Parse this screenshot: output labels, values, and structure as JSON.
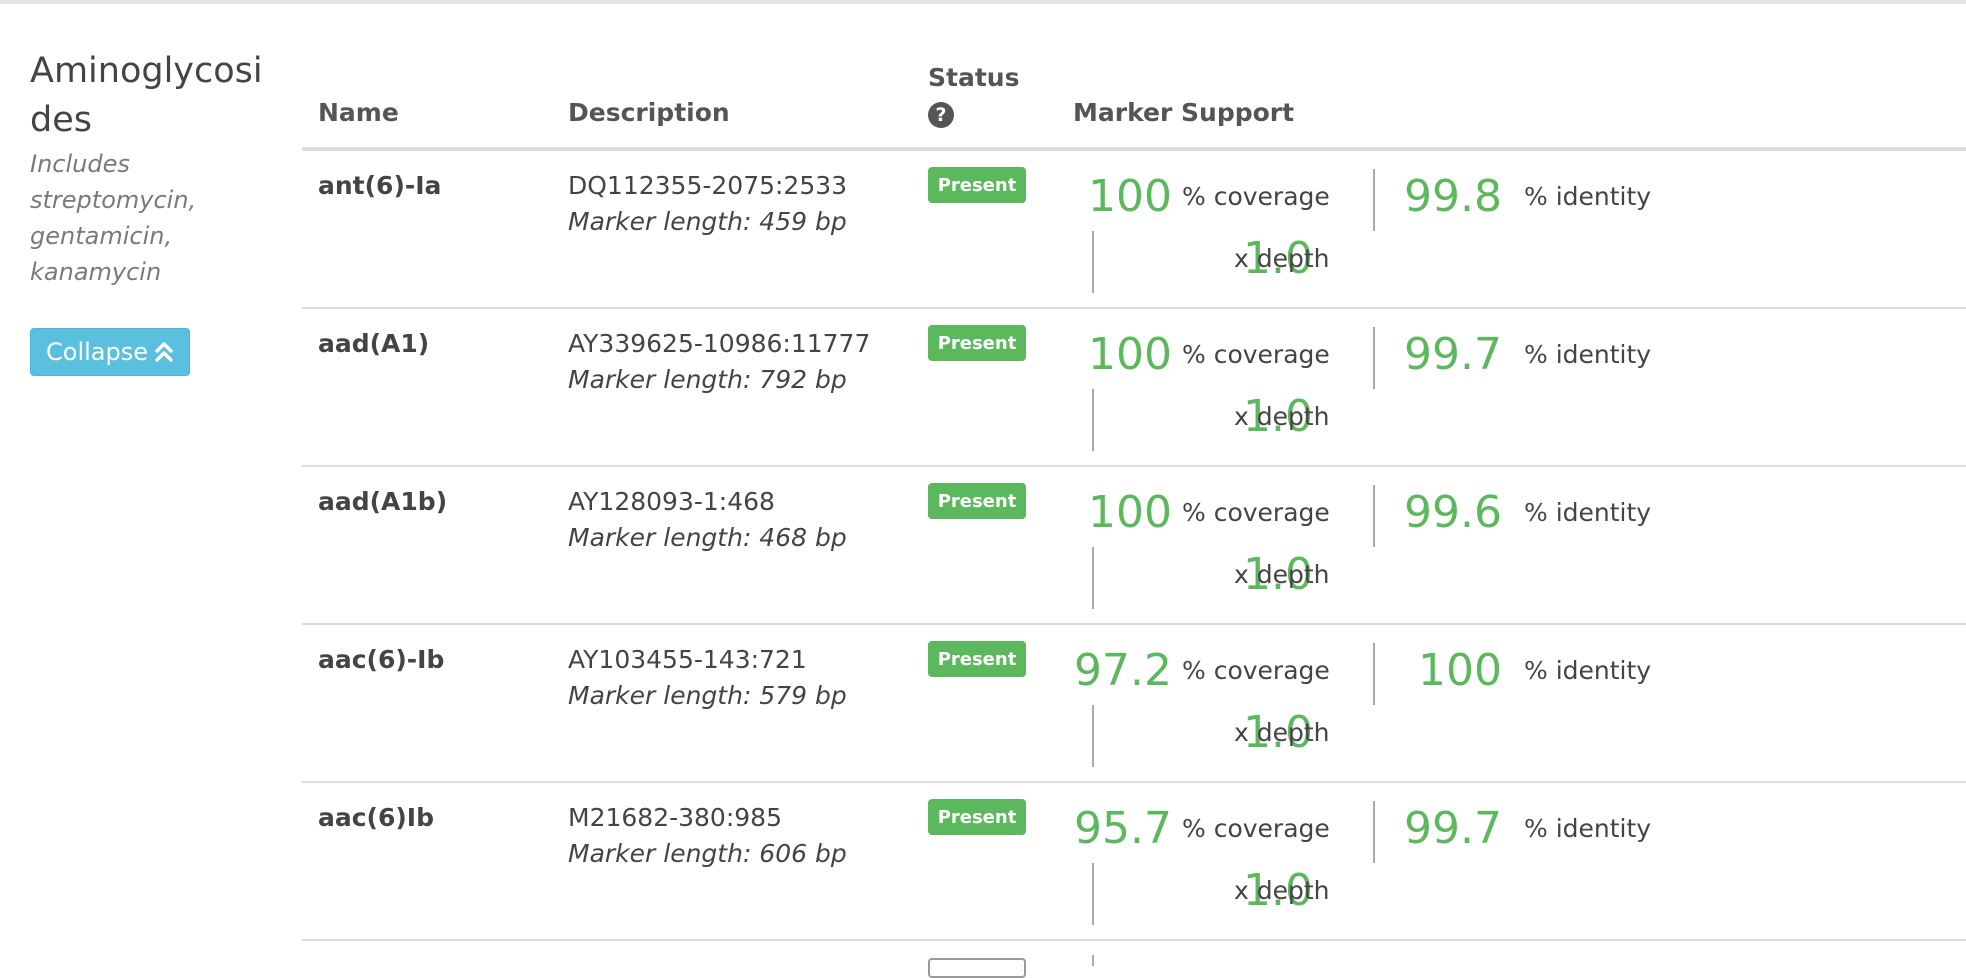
{
  "category": {
    "title": "Aminoglycosides",
    "description": "Includes streptomycin, gentamicin, kanamycin",
    "collapse_label": "Collapse"
  },
  "table": {
    "headers": {
      "name": "Name",
      "description": "Description",
      "status": "Status",
      "marker_support": "Marker Support"
    },
    "help_icon": "question-circle",
    "units": {
      "coverage": "% coverage",
      "identity": "% identity",
      "depth": "x depth"
    },
    "rows": [
      {
        "name": "ant(6)-Ia",
        "accession": "DQ112355-2075:2533",
        "marker_length": "Marker length: 459 bp",
        "status": "Present",
        "coverage": "100",
        "identity": "99.8",
        "depth": "1.0"
      },
      {
        "name": "aad(A1)",
        "accession": "AY339625-10986:11777",
        "marker_length": "Marker length: 792 bp",
        "status": "Present",
        "coverage": "100",
        "identity": "99.7",
        "depth": "1.0"
      },
      {
        "name": "aad(A1b)",
        "accession": "AY128093-1:468",
        "marker_length": "Marker length: 468 bp",
        "status": "Present",
        "coverage": "100",
        "identity": "99.6",
        "depth": "1.0"
      },
      {
        "name": "aac(6)-Ib",
        "accession": "AY103455-143:721",
        "marker_length": "Marker length: 579 bp",
        "status": "Present",
        "coverage": "97.2",
        "identity": "100",
        "depth": "1.0"
      },
      {
        "name": "aac(6)Ib",
        "accession": "M21682-380:985",
        "marker_length": "Marker length: 606 bp",
        "status": "Present",
        "coverage": "95.7",
        "identity": "99.7",
        "depth": "1.0"
      }
    ]
  },
  "colors": {
    "present": "#5cb85c",
    "value": "#5cb85c",
    "collapse_button": "#5bc0de"
  }
}
